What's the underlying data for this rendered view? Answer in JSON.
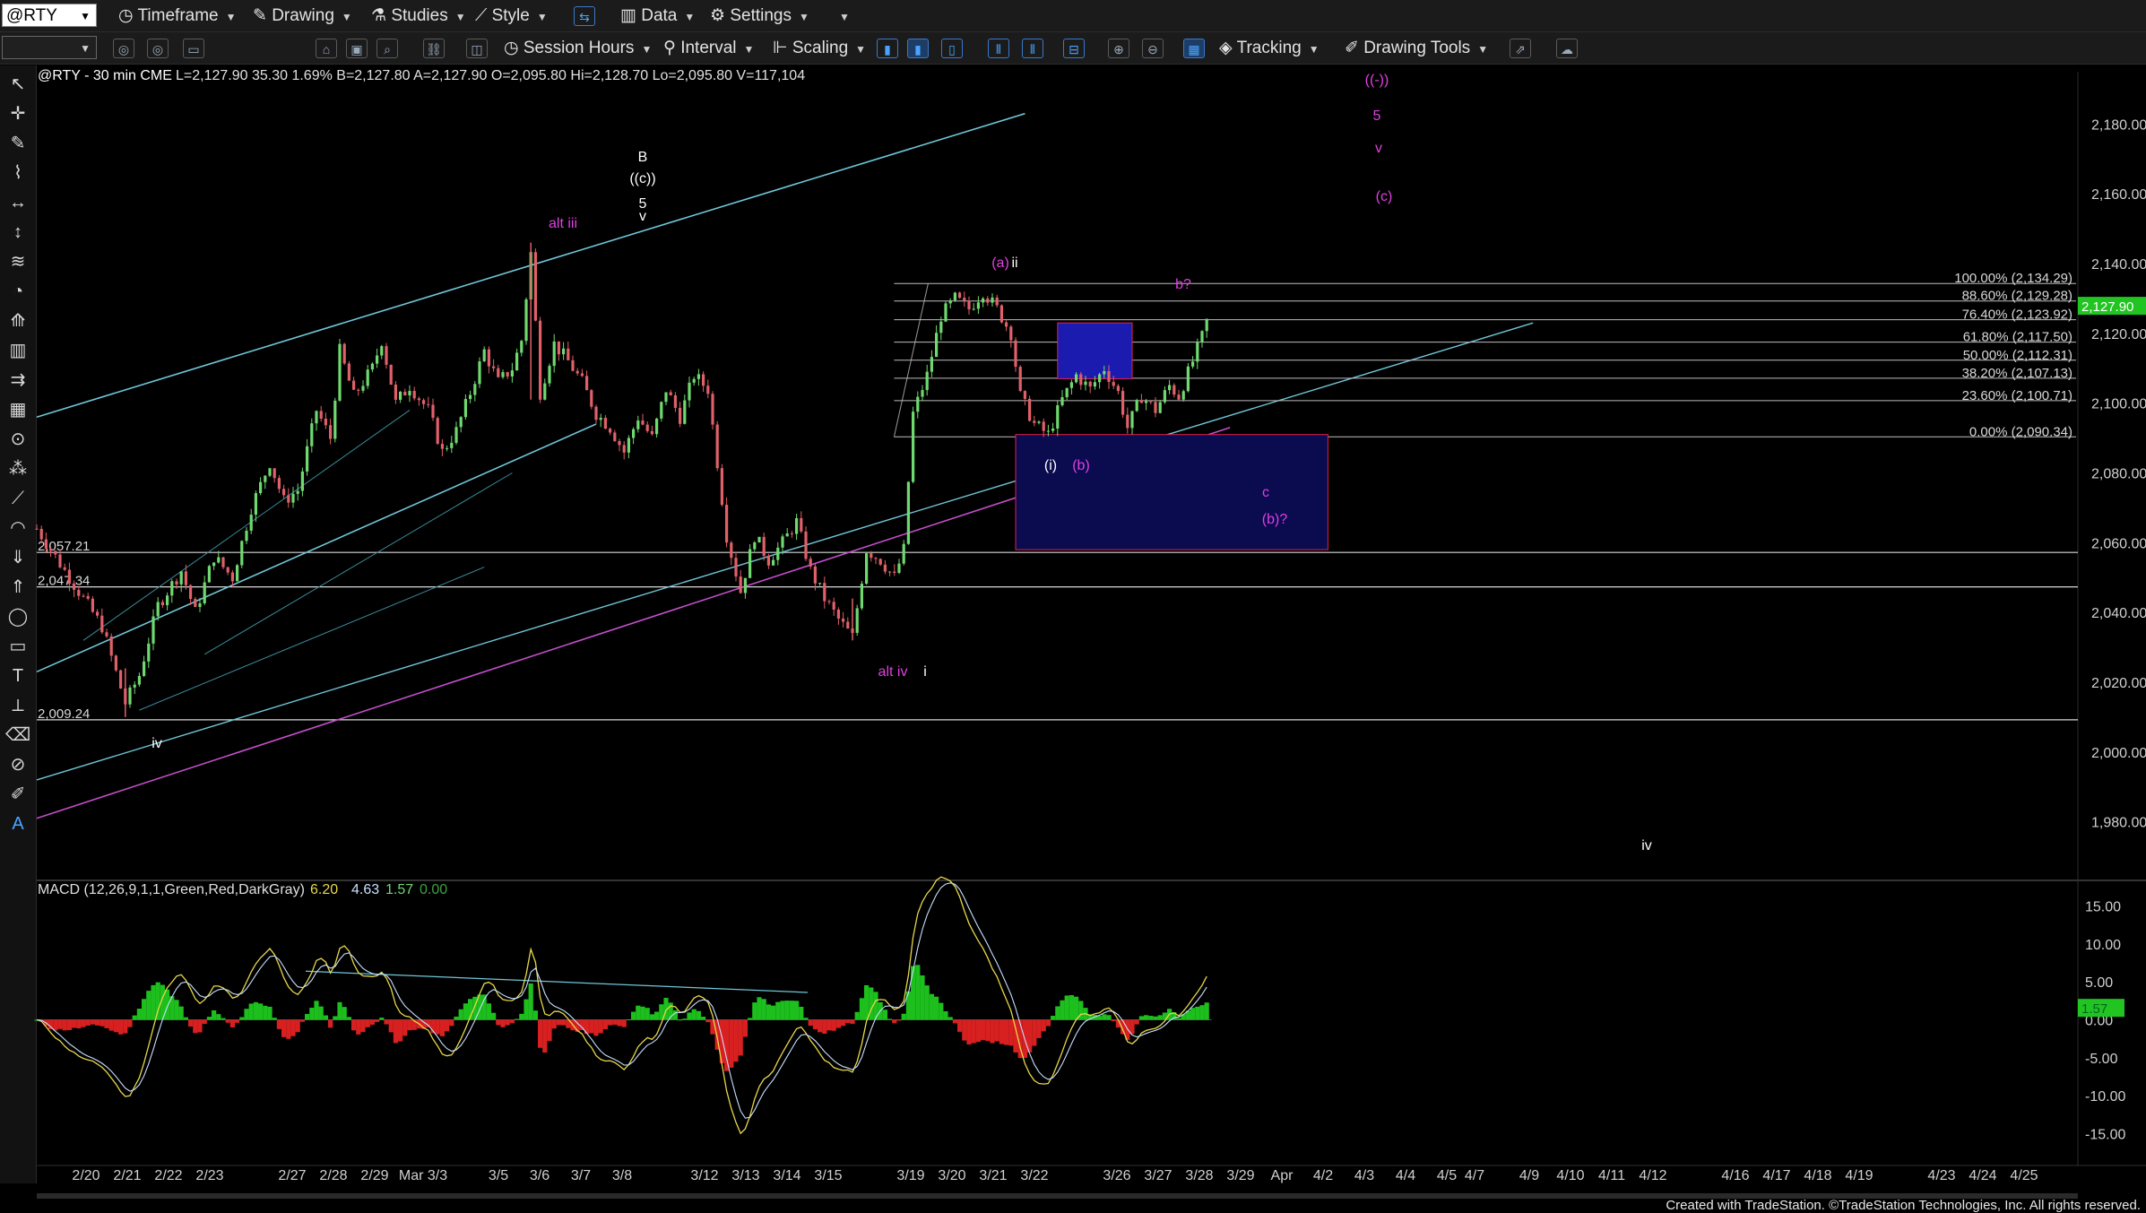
{
  "toolbar1": {
    "symbol": "@RTY",
    "items": [
      "Timeframe",
      "Drawing",
      "Studies",
      "Style",
      "Data",
      "Settings"
    ]
  },
  "toolbar2": {
    "items": [
      "Session Hours",
      "Interval",
      "Scaling",
      "Tracking",
      "Drawing Tools"
    ]
  },
  "left_tools": [
    "select-arrow-icon",
    "crosshair-icon",
    "pen-icon",
    "brush-icon",
    "horizontal-line-icon",
    "vertical-line-icon",
    "fib-tool-icon",
    "cycle-icon",
    "pitchfork-icon",
    "bar-tool-icon",
    "channel-icon",
    "grid-icon",
    "spiral-icon",
    "dots-icon",
    "line-tool-icon",
    "arc-icon",
    "arrow-down-icon",
    "arrow-up-icon",
    "ellipse-icon",
    "rectangle-icon",
    "text-tool-icon",
    "ruler-icon",
    "eraser-icon",
    "delete-icon",
    "paint-icon",
    "font-icon"
  ],
  "chart_data": {
    "type": "candlestick",
    "header": {
      "symbol_label": "@RTY - 30 min  CME",
      "stats": "L=2,127.90  35.30  1.69%  B=2,127.80  A=2,127.90  O=2,095.80  Hi=2,128.70  Lo=2,095.80  V=117,104"
    },
    "colors": {
      "up": "#6fd96f",
      "down": "#e0606a",
      "wave_white": "#ffffff",
      "wave_magenta": "#e040e0",
      "channel": "#6fc6d8",
      "support": "#c24fc9",
      "hline": "#d8d8d8",
      "last_price_bg": "#22c422",
      "macd_up": "#1dbf1d",
      "macd_down": "#d92020"
    },
    "price_axis": {
      "min": 1965,
      "max": 2195,
      "ticks": [
        "2,180.00",
        "2,160.00",
        "2,140.00",
        "2,120.00",
        "2,100.00",
        "2,080.00",
        "2,060.00",
        "2,040.00",
        "2,020.00",
        "2,000.00",
        "1,980.00"
      ]
    },
    "last_price": "2,127.90",
    "date_labels": [
      "2/20",
      "2/21",
      "2/22",
      "2/23",
      "2/27",
      "2/28",
      "2/29",
      "Mar 3/3",
      "3/5",
      "3/6",
      "3/7",
      "3/8",
      "3/12",
      "3/13",
      "3/14",
      "3/15",
      "3/19",
      "3/20",
      "3/21",
      "3/22",
      "3/26",
      "3/27",
      "3/28",
      "3/29",
      "Apr",
      "4/2",
      "4/3",
      "4/4",
      "4/5",
      "4/7",
      "4/9",
      "4/10",
      "4/11",
      "4/12",
      "4/16",
      "4/17",
      "4/18",
      "4/19",
      "4/23",
      "4/24",
      "4/25"
    ],
    "price_path": [
      [
        0,
        2064
      ],
      [
        3,
        2058
      ],
      [
        8,
        2048
      ],
      [
        14,
        2036
      ],
      [
        19,
        2014
      ],
      [
        22,
        2022
      ],
      [
        26,
        2042
      ],
      [
        31,
        2052
      ],
      [
        34,
        2040
      ],
      [
        38,
        2056
      ],
      [
        42,
        2050
      ],
      [
        46,
        2070
      ],
      [
        50,
        2083
      ],
      [
        53,
        2072
      ],
      [
        56,
        2075
      ],
      [
        60,
        2098
      ],
      [
        63,
        2090
      ],
      [
        65,
        2115
      ],
      [
        68,
        2102
      ],
      [
        72,
        2110
      ],
      [
        74,
        2118
      ],
      [
        77,
        2100
      ],
      [
        80,
        2105
      ],
      [
        84,
        2098
      ],
      [
        87,
        2086
      ],
      [
        90,
        2092
      ],
      [
        93,
        2103
      ],
      [
        96,
        2115
      ],
      [
        99,
        2106
      ],
      [
        102,
        2110
      ],
      [
        104,
        2118
      ],
      [
        106,
        2143
      ],
      [
        108,
        2103
      ],
      [
        111,
        2117
      ],
      [
        114,
        2112
      ],
      [
        117,
        2106
      ],
      [
        120,
        2097
      ],
      [
        123,
        2093
      ],
      [
        126,
        2086
      ],
      [
        129,
        2096
      ],
      [
        132,
        2090
      ],
      [
        135,
        2104
      ],
      [
        138,
        2096
      ],
      [
        141,
        2108
      ],
      [
        144,
        2104
      ],
      [
        146,
        2083
      ],
      [
        148,
        2062
      ],
      [
        151,
        2046
      ],
      [
        154,
        2062
      ],
      [
        157,
        2055
      ],
      [
        160,
        2060
      ],
      [
        163,
        2066
      ],
      [
        166,
        2052
      ],
      [
        169,
        2044
      ],
      [
        172,
        2038
      ],
      [
        175,
        2033
      ],
      [
        178,
        2058
      ],
      [
        181,
        2055
      ],
      [
        184,
        2050
      ],
      [
        186,
        2058
      ],
      [
        188,
        2097
      ],
      [
        191,
        2108
      ],
      [
        194,
        2125
      ],
      [
        197,
        2130
      ],
      [
        200,
        2127
      ],
      [
        203,
        2132
      ],
      [
        206,
        2127
      ],
      [
        209,
        2120
      ],
      [
        211,
        2102
      ],
      [
        214,
        2094
      ],
      [
        217,
        2091
      ],
      [
        220,
        2101
      ],
      [
        223,
        2108
      ],
      [
        226,
        2104
      ],
      [
        229,
        2110
      ],
      [
        232,
        2103
      ],
      [
        234,
        2093
      ],
      [
        237,
        2102
      ],
      [
        240,
        2098
      ],
      [
        243,
        2105
      ],
      [
        245,
        2102
      ],
      [
        248,
        2112
      ],
      [
        250,
        2119
      ],
      [
        252,
        2127.9
      ]
    ],
    "fib_levels": [
      {
        "pct": "100.00%",
        "value": "(2,134.29)"
      },
      {
        "pct": "88.60%",
        "value": "(2,129.28)"
      },
      {
        "pct": "76.40%",
        "value": "(2,123.92)"
      },
      {
        "pct": "61.80%",
        "value": "(2,117.50)"
      },
      {
        "pct": "50.00%",
        "value": "(2,112.31)"
      },
      {
        "pct": "38.20%",
        "value": "(2,107.13)"
      },
      {
        "pct": "23.60%",
        "value": "(2,100.71)"
      },
      {
        "pct": "0.00%",
        "value": "(2,090.34)"
      }
    ],
    "fib_prices": [
      2134.29,
      2129.28,
      2123.92,
      2117.5,
      2112.31,
      2107.13,
      2100.71,
      2090.34
    ],
    "hlines": [
      {
        "label": "2,057.21",
        "price": 2057.21
      },
      {
        "label": "2,047.34",
        "price": 2047.34
      },
      {
        "label": "2,009.24",
        "price": 2009.24
      }
    ],
    "wave_labels": [
      {
        "text": "B",
        "color": "white"
      },
      {
        "text": "((c))",
        "color": "white"
      },
      {
        "text": "5",
        "color": "white"
      },
      {
        "text": "v",
        "color": "white"
      },
      {
        "text": "alt iii",
        "color": "magenta"
      },
      {
        "text": "(a)",
        "color": "magenta"
      },
      {
        "text": "ii",
        "color": "white"
      },
      {
        "text": "b?",
        "color": "magenta"
      },
      {
        "text": "((-))",
        "color": "magenta"
      },
      {
        "text": "5",
        "color": "magenta"
      },
      {
        "text": "v",
        "color": "magenta"
      },
      {
        "text": "(c)",
        "color": "magenta"
      },
      {
        "text": "(i)",
        "color": "white"
      },
      {
        "text": "(b)",
        "color": "magenta"
      },
      {
        "text": "c",
        "color": "magenta"
      },
      {
        "text": "(b)?",
        "color": "magenta"
      },
      {
        "text": "alt iv",
        "color": "magenta"
      },
      {
        "text": "i",
        "color": "white"
      },
      {
        "text": "iv",
        "color": "white"
      },
      {
        "text": "iv",
        "color": "white"
      }
    ],
    "macd": {
      "label": "MACD (12,26,9,1,1,Green,Red,DarkGray)",
      "values": [
        "6.20",
        "4.63",
        "1.57",
        "0.00"
      ],
      "value_colors": [
        "#e8d84a",
        "#c8e0ff",
        "#6fd96f",
        "#3fa03f"
      ],
      "ticks": [
        "15.00",
        "10.00",
        "5.00",
        "0.00",
        "-5.00",
        "-10.00",
        "-15.00"
      ],
      "last_hist": "1.57"
    }
  },
  "footer": "Created with TradeStation. ©TradeStation Technologies, Inc. All rights reserved."
}
